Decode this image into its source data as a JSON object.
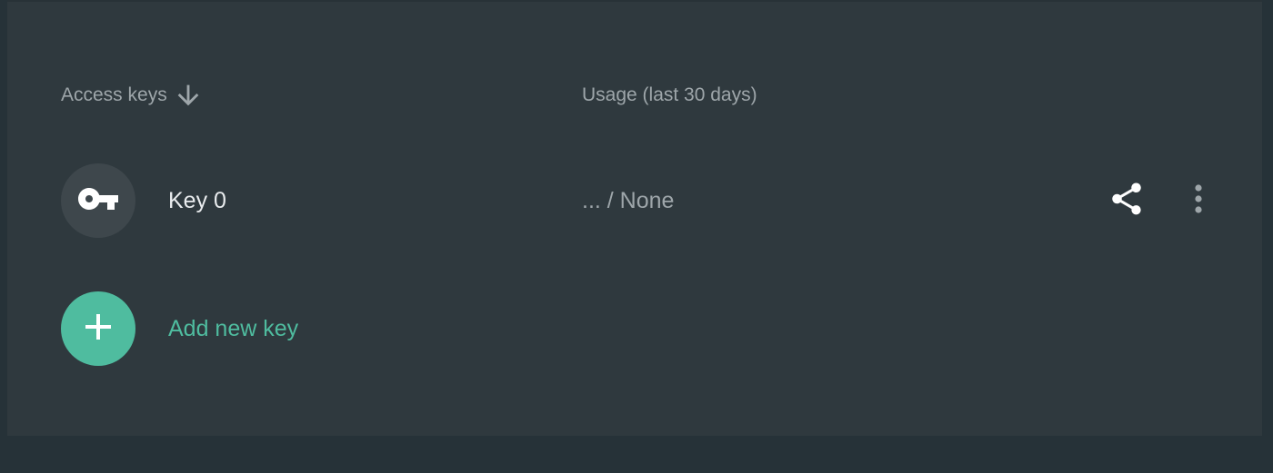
{
  "table": {
    "header": {
      "access_keys_label": "Access keys",
      "usage_label": "Usage (last 30 days)",
      "sort_icon": "arrow-down-icon"
    },
    "keys": [
      {
        "name": "Key 0",
        "usage": "... / None",
        "icon": "key-icon"
      }
    ],
    "add_key": {
      "label": "Add new key",
      "icon": "plus-icon"
    }
  },
  "colors": {
    "accent": "#4fbc9f",
    "page_background": "#263238",
    "card_background": "#2f393e",
    "muted_text": "#9ea6aa",
    "primary_text": "#e9ecee"
  }
}
